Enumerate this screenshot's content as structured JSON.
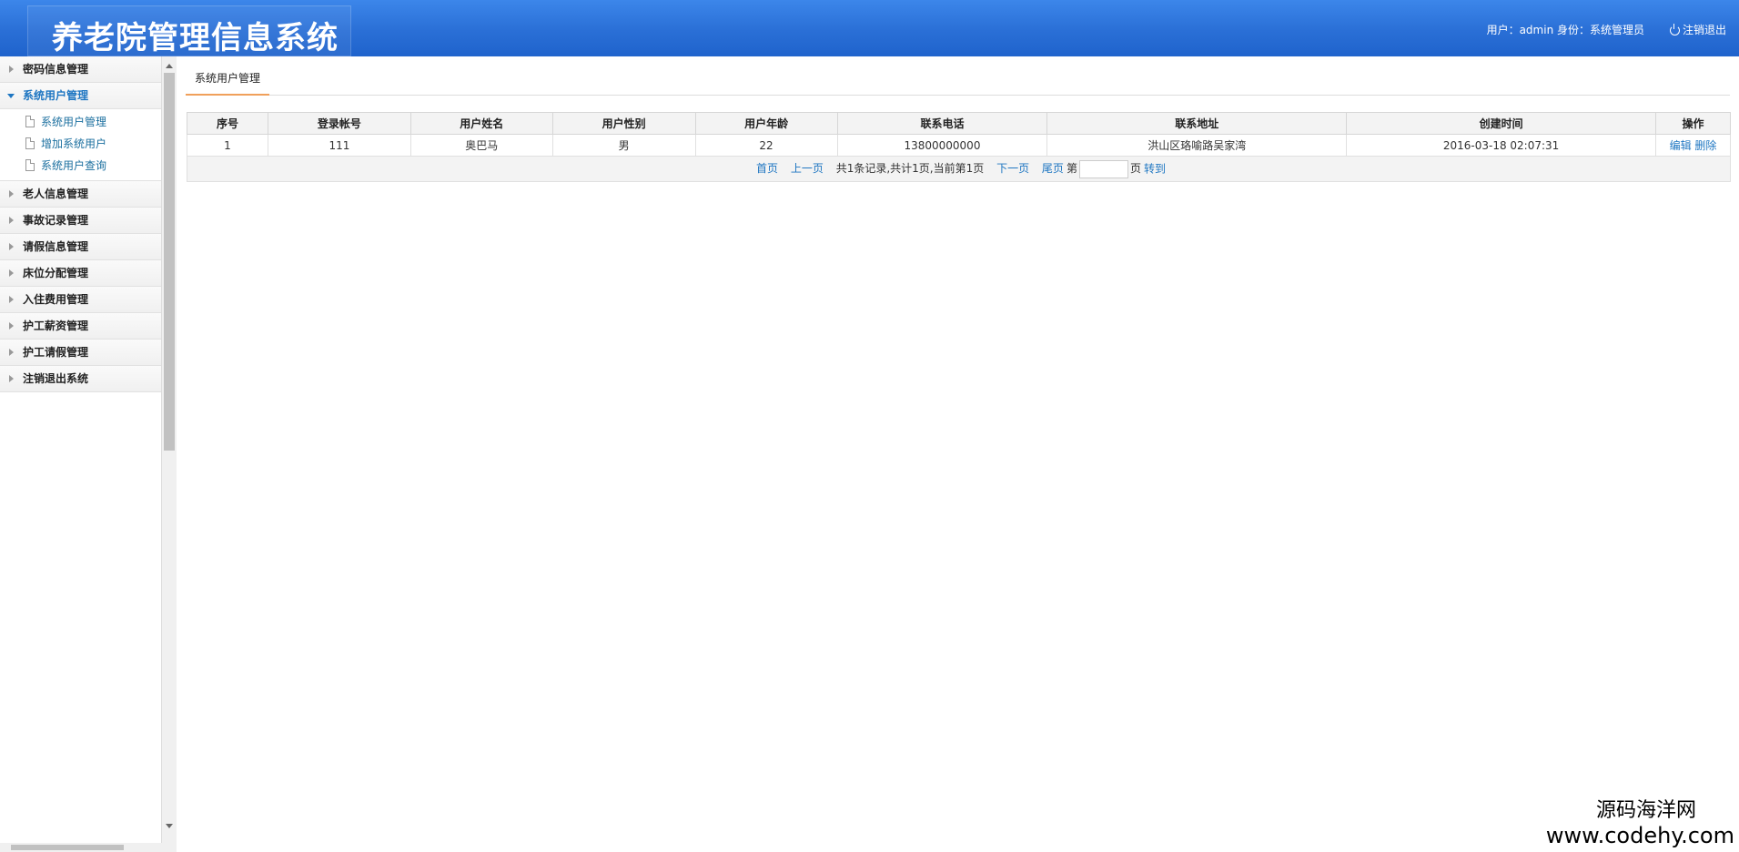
{
  "header": {
    "title": "养老院管理信息系统",
    "user_info": "用户：admin 身份：系统管理员",
    "logout": "注销退出"
  },
  "sidebar": {
    "groups": [
      {
        "label": "密码信息管理"
      },
      {
        "label": "系统用户管理",
        "open": true,
        "items": [
          {
            "label": "系统用户管理"
          },
          {
            "label": "增加系统用户"
          },
          {
            "label": "系统用户查询"
          }
        ]
      },
      {
        "label": "老人信息管理"
      },
      {
        "label": "事故记录管理"
      },
      {
        "label": "请假信息管理"
      },
      {
        "label": "床位分配管理"
      },
      {
        "label": "入住费用管理"
      },
      {
        "label": "护工薪资管理"
      },
      {
        "label": "护工请假管理"
      },
      {
        "label": "注销退出系统"
      }
    ]
  },
  "main": {
    "tab": "系统用户管理",
    "table": {
      "headers": [
        "序号",
        "登录帐号",
        "用户姓名",
        "用户性别",
        "用户年龄",
        "联系电话",
        "联系地址",
        "创建时间",
        "操作"
      ],
      "rows": [
        {
          "no": "1",
          "account": "111",
          "name": "奥巴马",
          "gender": "男",
          "age": "22",
          "phone": "13800000000",
          "address": "洪山区珞喻路吴家湾",
          "created": "2016-03-18 02:07:31",
          "edit": "编辑",
          "delete": "删除"
        }
      ]
    },
    "pager": {
      "first": "首页",
      "prev": "上一页",
      "summary": "共1条记录,共计1页,当前第1页",
      "next": "下一页",
      "last": "尾页",
      "page_prefix": "第",
      "page_suffix": "页",
      "go": "转到"
    }
  },
  "watermark": {
    "line1": "源码海洋网",
    "line2": "www.codehy.com"
  }
}
